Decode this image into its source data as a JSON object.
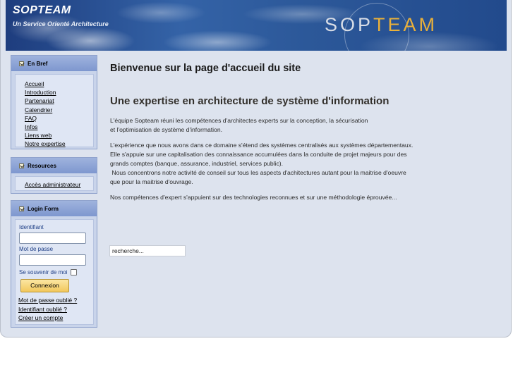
{
  "banner": {
    "site_name": "SOPTEAM",
    "tagline": "Un Service Orienté Architecture",
    "logo_prefix": "SOP",
    "logo_accent": "TEAM"
  },
  "sidebar": {
    "en_bref": {
      "title": "En Bref",
      "items": [
        "Accueil",
        "Introduction",
        "Partenariat",
        "Calendrier",
        "FAQ",
        "Infos",
        "Liens web",
        "Notre expertise"
      ]
    },
    "resources": {
      "title": "Resources",
      "items": [
        "Accès administrateur"
      ]
    },
    "login": {
      "title": "Login Form",
      "identifiant_label": "Identifiant",
      "identifiant_value": "",
      "password_label": "Mot de passe",
      "password_value": "",
      "remember_label": "Se souvenir de moi",
      "submit_label": "Connexion",
      "forgot_password": "Mot de passe oublié ?",
      "forgot_login": "Identifiant oublié ?",
      "create_account": "Créer un compte"
    }
  },
  "main": {
    "page_title": "Bienvenue sur la page d'accueil du site",
    "subtitle": "Une expertise en architecture de système d'information",
    "paragraph1": [
      "L'équipe Sopteam  réuni les compétences d'architectes experts sur la conception, la sécurisation",
      "et l'optimisation de système d'information."
    ],
    "paragraph2": [
      "L'expérience que nous avons dans ce domaine s'étend des systèmes centralisés aux systèmes départementaux.",
      "Elle s'appuie sur une capitalisation des connaissance accumulées dans la conduite de projet majeurs pour des",
      "grands comptes (banque, assurance, industriel, services public).",
      " Nous concentrons notre activité de conseil sur tous les aspects d'achitectures autant pour la maitrise d'oeuvre",
      "que pour la maitrise d'ouvrage."
    ],
    "paragraph3": "Nos compétences d'expert s'appuient sur des technologies reconnues et sur une méthodologie éprouvée..."
  },
  "search": {
    "value": "recherche..."
  },
  "colors": {
    "accent": "#e9b03a",
    "header_blue": "#2c5899",
    "box_head": "#8aa0d4",
    "button": "#f5d27a"
  }
}
